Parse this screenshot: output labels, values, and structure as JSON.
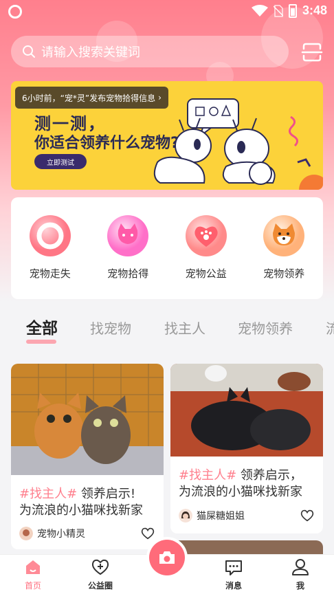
{
  "status_bar": {
    "time": "3:48"
  },
  "search": {
    "placeholder": "请输入搜索关键词"
  },
  "banner": {
    "toast": "6小时前，“宠*灵”发布宠物拾得信息",
    "toast_arrow": "›",
    "line1": "测一测，",
    "line2": "你适合领养什么宠物?",
    "button_label": "立即测试"
  },
  "categories": [
    {
      "label": "宠物走失",
      "icon": "ring-icon"
    },
    {
      "label": "宠物拾得",
      "icon": "cat-face-icon"
    },
    {
      "label": "宠物公益",
      "icon": "heart-paw-icon"
    },
    {
      "label": "宠物领养",
      "icon": "shiba-icon"
    }
  ],
  "tabs": [
    "全部",
    "找宠物",
    "找主人",
    "宠物领养",
    "流浪"
  ],
  "feed": [
    {
      "tag": "#找主人#",
      "title_rest": " 领养启示!",
      "title_line2": "为流浪的小猫咪找新家",
      "author": "宠物小精灵"
    },
    {
      "tag": "#找主人#",
      "title_rest": " 领养启示，",
      "title_line2": "为流浪的小猫咪找新家",
      "author": "猫屎糖姐姐"
    }
  ],
  "bottom_nav": [
    {
      "label": "首页",
      "icon": "home-icon",
      "active": true
    },
    {
      "label": "公益圈",
      "icon": "heart-plus-icon",
      "active": false
    },
    {
      "label": "消息",
      "icon": "message-icon",
      "active": false
    },
    {
      "label": "我",
      "icon": "user-icon",
      "active": false
    }
  ],
  "colors": {
    "accent": "#ff7f8d",
    "banner_yellow": "#fcd23a",
    "nav_active": "#ff6f7f"
  }
}
